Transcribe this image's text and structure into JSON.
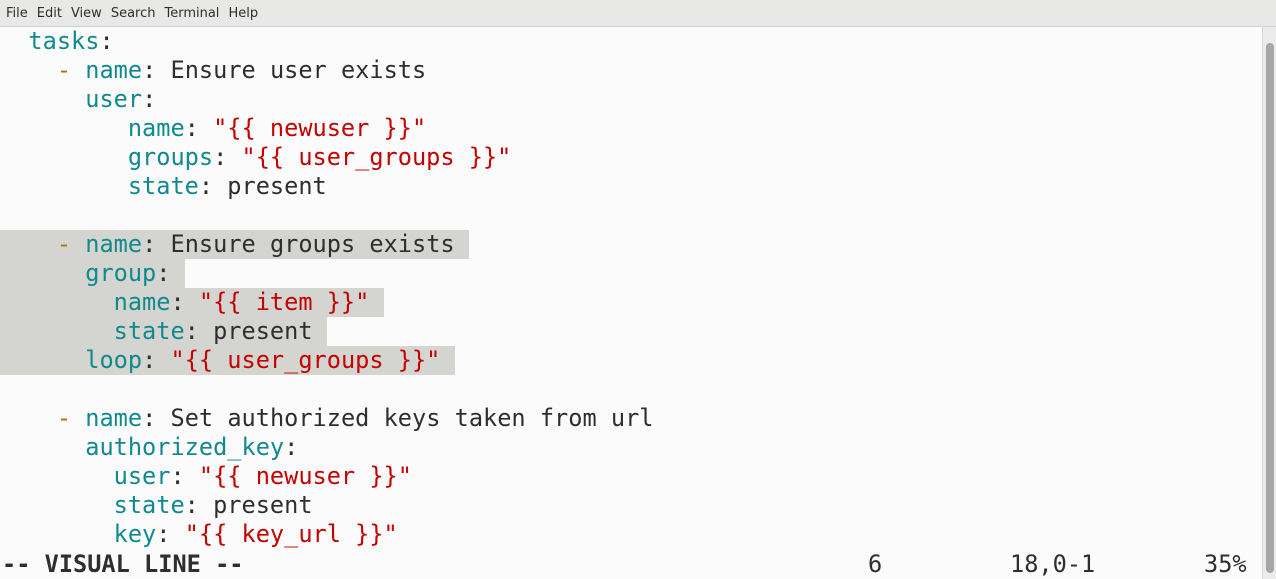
{
  "menu": [
    "File",
    "Edit",
    "View",
    "Search",
    "Terminal",
    "Help"
  ],
  "lines": [
    [
      {
        "t": "  "
      },
      {
        "t": "tasks",
        "c": "key"
      },
      {
        "t": ":",
        "c": "plain"
      }
    ],
    [
      {
        "t": "    "
      },
      {
        "t": "-",
        "c": "dash"
      },
      {
        "t": " "
      },
      {
        "t": "name",
        "c": "key"
      },
      {
        "t": ": "
      },
      {
        "t": "Ensure user exists",
        "c": "plain"
      }
    ],
    [
      {
        "t": "      "
      },
      {
        "t": "user",
        "c": "key"
      },
      {
        "t": ":"
      }
    ],
    [
      {
        "t": "         "
      },
      {
        "t": "name",
        "c": "key"
      },
      {
        "t": ": "
      },
      {
        "t": "\"{{ newuser }}\"",
        "c": "str"
      }
    ],
    [
      {
        "t": "         "
      },
      {
        "t": "groups",
        "c": "key"
      },
      {
        "t": ": "
      },
      {
        "t": "\"{{ user_groups }}\"",
        "c": "str"
      }
    ],
    [
      {
        "t": "         "
      },
      {
        "t": "state",
        "c": "key"
      },
      {
        "t": ": "
      },
      {
        "t": "present",
        "c": "plain"
      }
    ],
    [],
    [
      {
        "t": "    "
      },
      {
        "t": "-",
        "c": "dash"
      },
      {
        "t": " "
      },
      {
        "t": "name",
        "c": "key"
      },
      {
        "t": ": "
      },
      {
        "t": "Ensure groups exists ",
        "c": "plain"
      }
    ],
    [
      {
        "t": "      "
      },
      {
        "t": "group",
        "c": "key"
      },
      {
        "t": ": "
      }
    ],
    [
      {
        "t": "        "
      },
      {
        "t": "name",
        "c": "key"
      },
      {
        "t": ": "
      },
      {
        "t": "\"{{ item }}\" ",
        "c": "str"
      }
    ],
    [
      {
        "t": "        "
      },
      {
        "t": "state",
        "c": "key"
      },
      {
        "t": ": "
      },
      {
        "t": "present ",
        "c": "plain"
      }
    ],
    [
      {
        "t": "      "
      },
      {
        "t": "loop",
        "c": "key"
      },
      {
        "t": ": "
      },
      {
        "t": "\"{{ user_groups }}\" ",
        "c": "str"
      }
    ],
    [],
    [
      {
        "t": "    "
      },
      {
        "t": "-",
        "c": "dash"
      },
      {
        "t": " "
      },
      {
        "t": "name",
        "c": "key"
      },
      {
        "t": ": "
      },
      {
        "t": "Set authorized keys taken from url",
        "c": "plain"
      }
    ],
    [
      {
        "t": "      "
      },
      {
        "t": "authorized_key",
        "c": "key"
      },
      {
        "t": ":"
      }
    ],
    [
      {
        "t": "        "
      },
      {
        "t": "user",
        "c": "key"
      },
      {
        "t": ": "
      },
      {
        "t": "\"{{ newuser }}\"",
        "c": "str"
      }
    ],
    [
      {
        "t": "        "
      },
      {
        "t": "state",
        "c": "key"
      },
      {
        "t": ": "
      },
      {
        "t": "present",
        "c": "plain"
      }
    ],
    [
      {
        "t": "        "
      },
      {
        "t": "key",
        "c": "key"
      },
      {
        "t": ": "
      },
      {
        "t": "\"{{ key_url }}\"",
        "c": "str"
      }
    ]
  ],
  "selected_lines": [
    7,
    8,
    9,
    10,
    11
  ],
  "status": {
    "mode": "-- VISUAL LINE --",
    "selection_count": "6",
    "cursor": "18,0-1",
    "percent": "35%"
  }
}
